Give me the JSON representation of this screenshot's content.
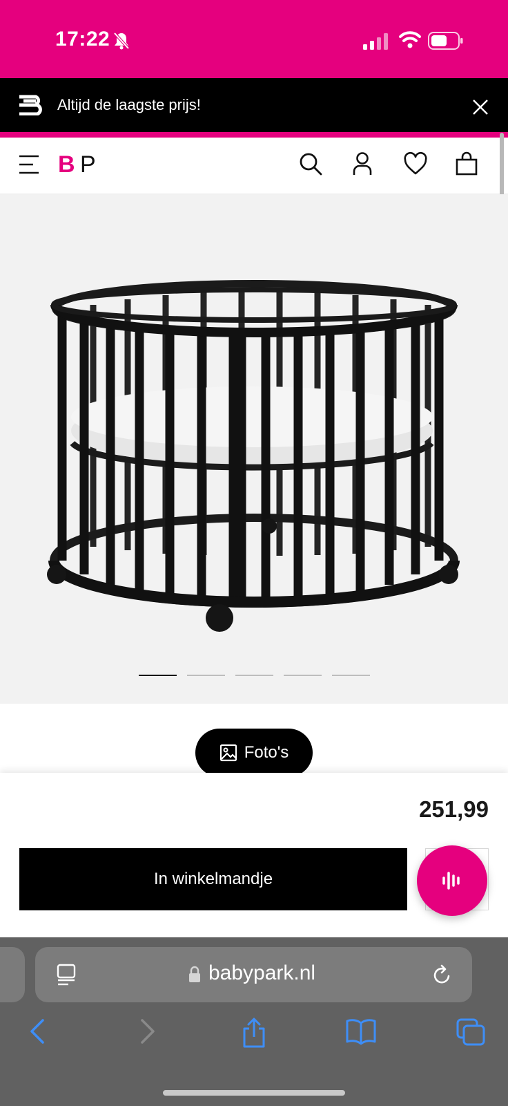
{
  "status": {
    "time": "17:22"
  },
  "promo": {
    "text": "Altijd de laagste prijs!"
  },
  "header": {
    "logo_text": "BP",
    "icons": [
      "menu-icon",
      "search-icon",
      "account-icon",
      "heart-icon",
      "bag-icon"
    ]
  },
  "gallery": {
    "slide_count": 5,
    "active_slide": 1,
    "photos_label": "Foto's"
  },
  "product": {
    "price": "251,99",
    "add_to_cart_label": "In winkelmandje"
  },
  "browser": {
    "url": "babypark.nl"
  },
  "colors": {
    "brand_pink": "#e5007e",
    "black": "#000000"
  }
}
